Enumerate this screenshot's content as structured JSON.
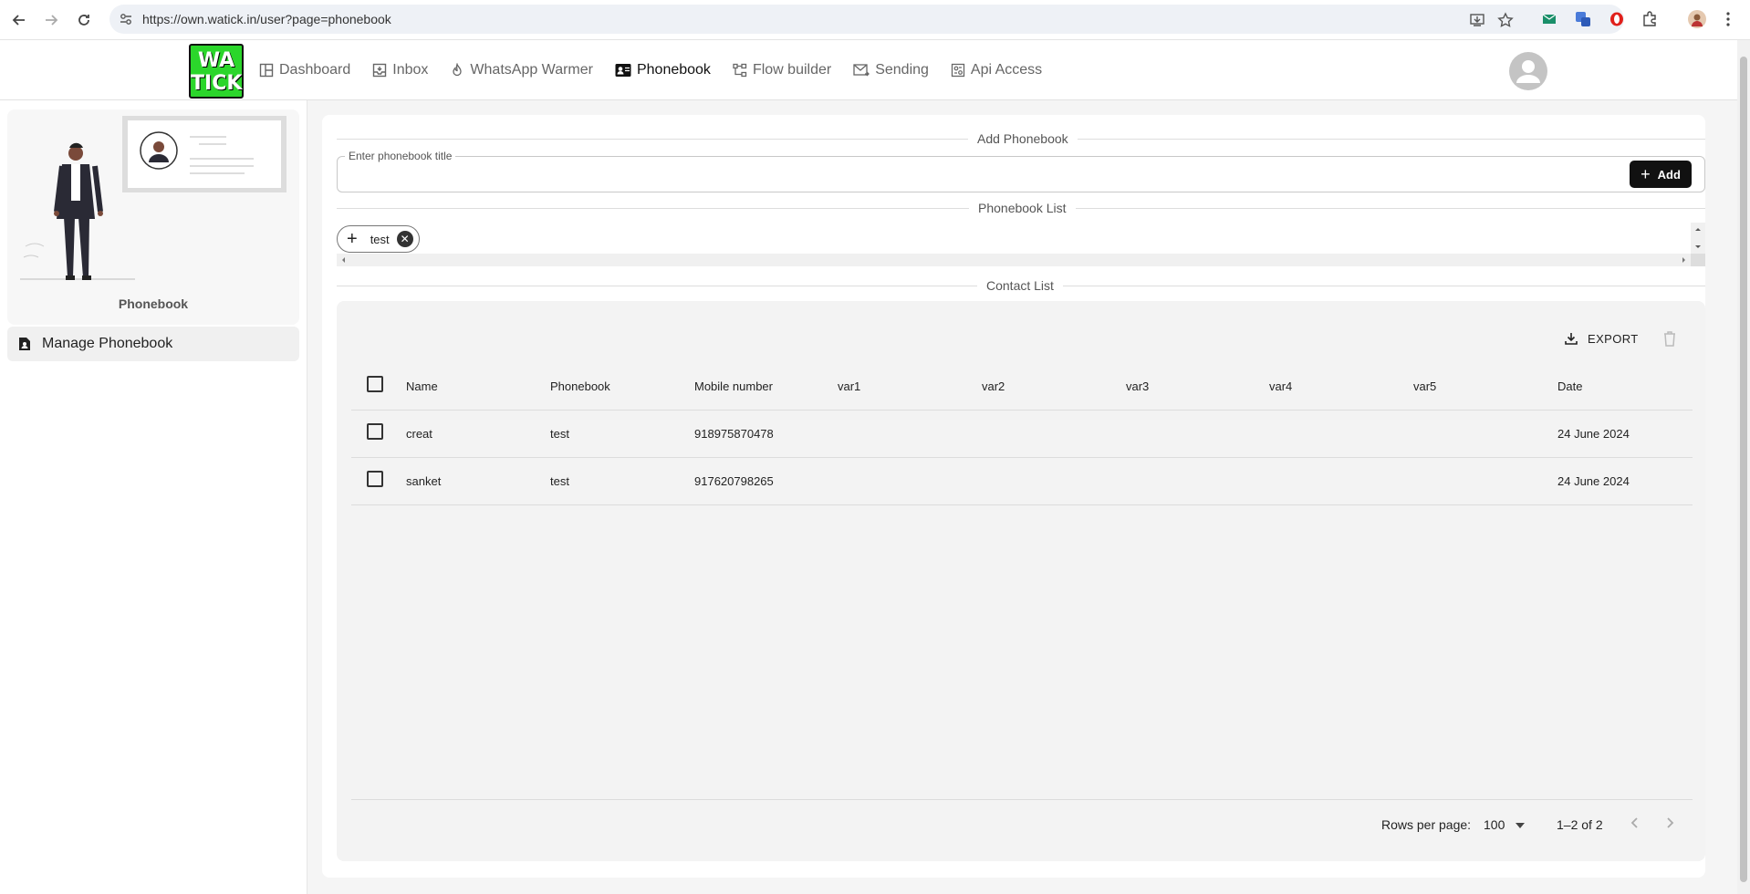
{
  "browser": {
    "url": "https://own.watick.in/user?page=phonebook"
  },
  "logo": {
    "line1": "WA",
    "line2": "TICK"
  },
  "nav": {
    "items": [
      {
        "label": "Dashboard",
        "icon": "dashboard-icon"
      },
      {
        "label": "Inbox",
        "icon": "inbox-icon"
      },
      {
        "label": "WhatsApp Warmer",
        "icon": "flame-icon"
      },
      {
        "label": "Phonebook",
        "icon": "contacts-icon",
        "active": true
      },
      {
        "label": "Flow builder",
        "icon": "flow-icon"
      },
      {
        "label": "Sending",
        "icon": "mail-icon"
      },
      {
        "label": "Api Access",
        "icon": "api-icon"
      }
    ]
  },
  "sidebar": {
    "card_label": "Phonebook",
    "items": [
      {
        "label": "Manage Phonebook",
        "icon": "contact-page-icon"
      }
    ]
  },
  "add_section": {
    "heading": "Add Phonebook",
    "field_label": "Enter phonebook title",
    "field_value": "",
    "button_label": "Add"
  },
  "list_section": {
    "heading": "Phonebook List",
    "chips": [
      {
        "label": "test"
      }
    ]
  },
  "contact_section": {
    "heading": "Contact List",
    "export_label": "EXPORT",
    "columns": [
      "Name",
      "Phonebook",
      "Mobile number",
      "var1",
      "var2",
      "var3",
      "var4",
      "var5",
      "Date"
    ],
    "rows": [
      {
        "name": "creat",
        "phonebook": "test",
        "mobile": "918975870478",
        "var1": "",
        "var2": "",
        "var3": "",
        "var4": "",
        "var5": "",
        "date": "24 June 2024"
      },
      {
        "name": "sanket",
        "phonebook": "test",
        "mobile": "917620798265",
        "var1": "",
        "var2": "",
        "var3": "",
        "var4": "",
        "var5": "",
        "date": "24 June 2024"
      }
    ],
    "pagination": {
      "rows_per_page_label": "Rows per page:",
      "rows_per_page": "100",
      "range": "1–2 of 2"
    }
  },
  "colors": {
    "logo_green": "#2bd62b",
    "active_text": "#111111",
    "button_dark": "#111111"
  }
}
